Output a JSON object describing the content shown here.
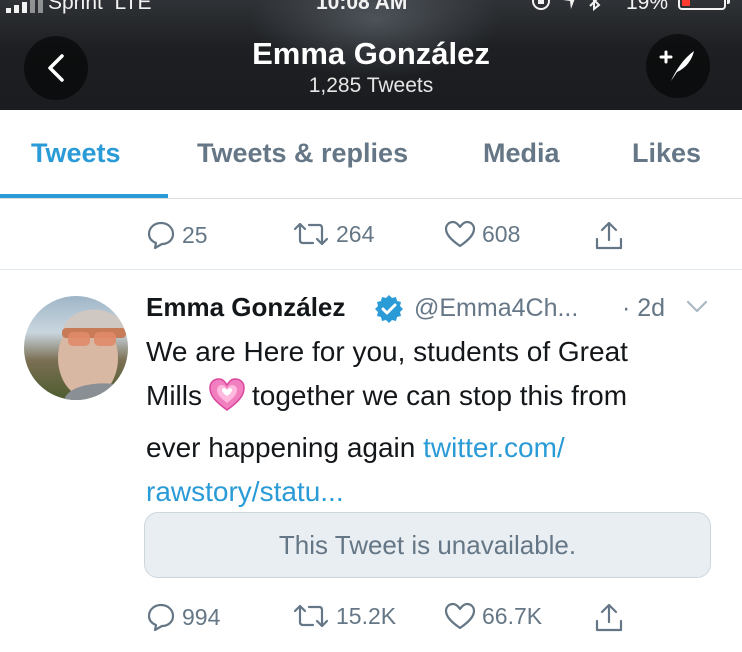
{
  "status_bar": {
    "carrier": "Sprint  LTE",
    "time": "10:08 AM",
    "battery_percent_label": "19%",
    "battery_level": 0.19
  },
  "header": {
    "title": "Emma González",
    "tweet_count": "1,285 Tweets"
  },
  "tabs": [
    {
      "label": "Tweets",
      "active": true
    },
    {
      "label": "Tweets & replies",
      "active": false
    },
    {
      "label": "Media",
      "active": false
    },
    {
      "label": "Likes",
      "active": false
    }
  ],
  "previous_tweet_actions": {
    "replies": "25",
    "retweets": "264",
    "likes": "608"
  },
  "tweet": {
    "author_name": "Emma González",
    "handle": "@Emma4Ch...",
    "time": "· 2d",
    "text_line1": "We are Here for you, students of Great",
    "text_line2a": "Mills",
    "text_line2b": "together we can stop this from",
    "text_line3": "ever happening again",
    "link_part1": "twitter.com/",
    "link_part2": "rawstory/statu...",
    "quote_unavailable": "This Tweet is unavailable.",
    "actions": {
      "replies": "994",
      "retweets": "15.2K",
      "likes": "66.7K"
    }
  },
  "icons": {
    "back": "chevron-left-icon",
    "compose": "compose-feather-icon",
    "reply": "reply-icon",
    "retweet": "retweet-icon",
    "like": "heart-outline-icon",
    "share": "share-icon",
    "verified": "verified-badge-icon",
    "emoji": "growing-heart-emoji"
  },
  "colors": {
    "accent": "#2a9bd6",
    "muted": "#657786",
    "header_bg": "#1d1f22",
    "battery_low": "#ff3b30"
  }
}
